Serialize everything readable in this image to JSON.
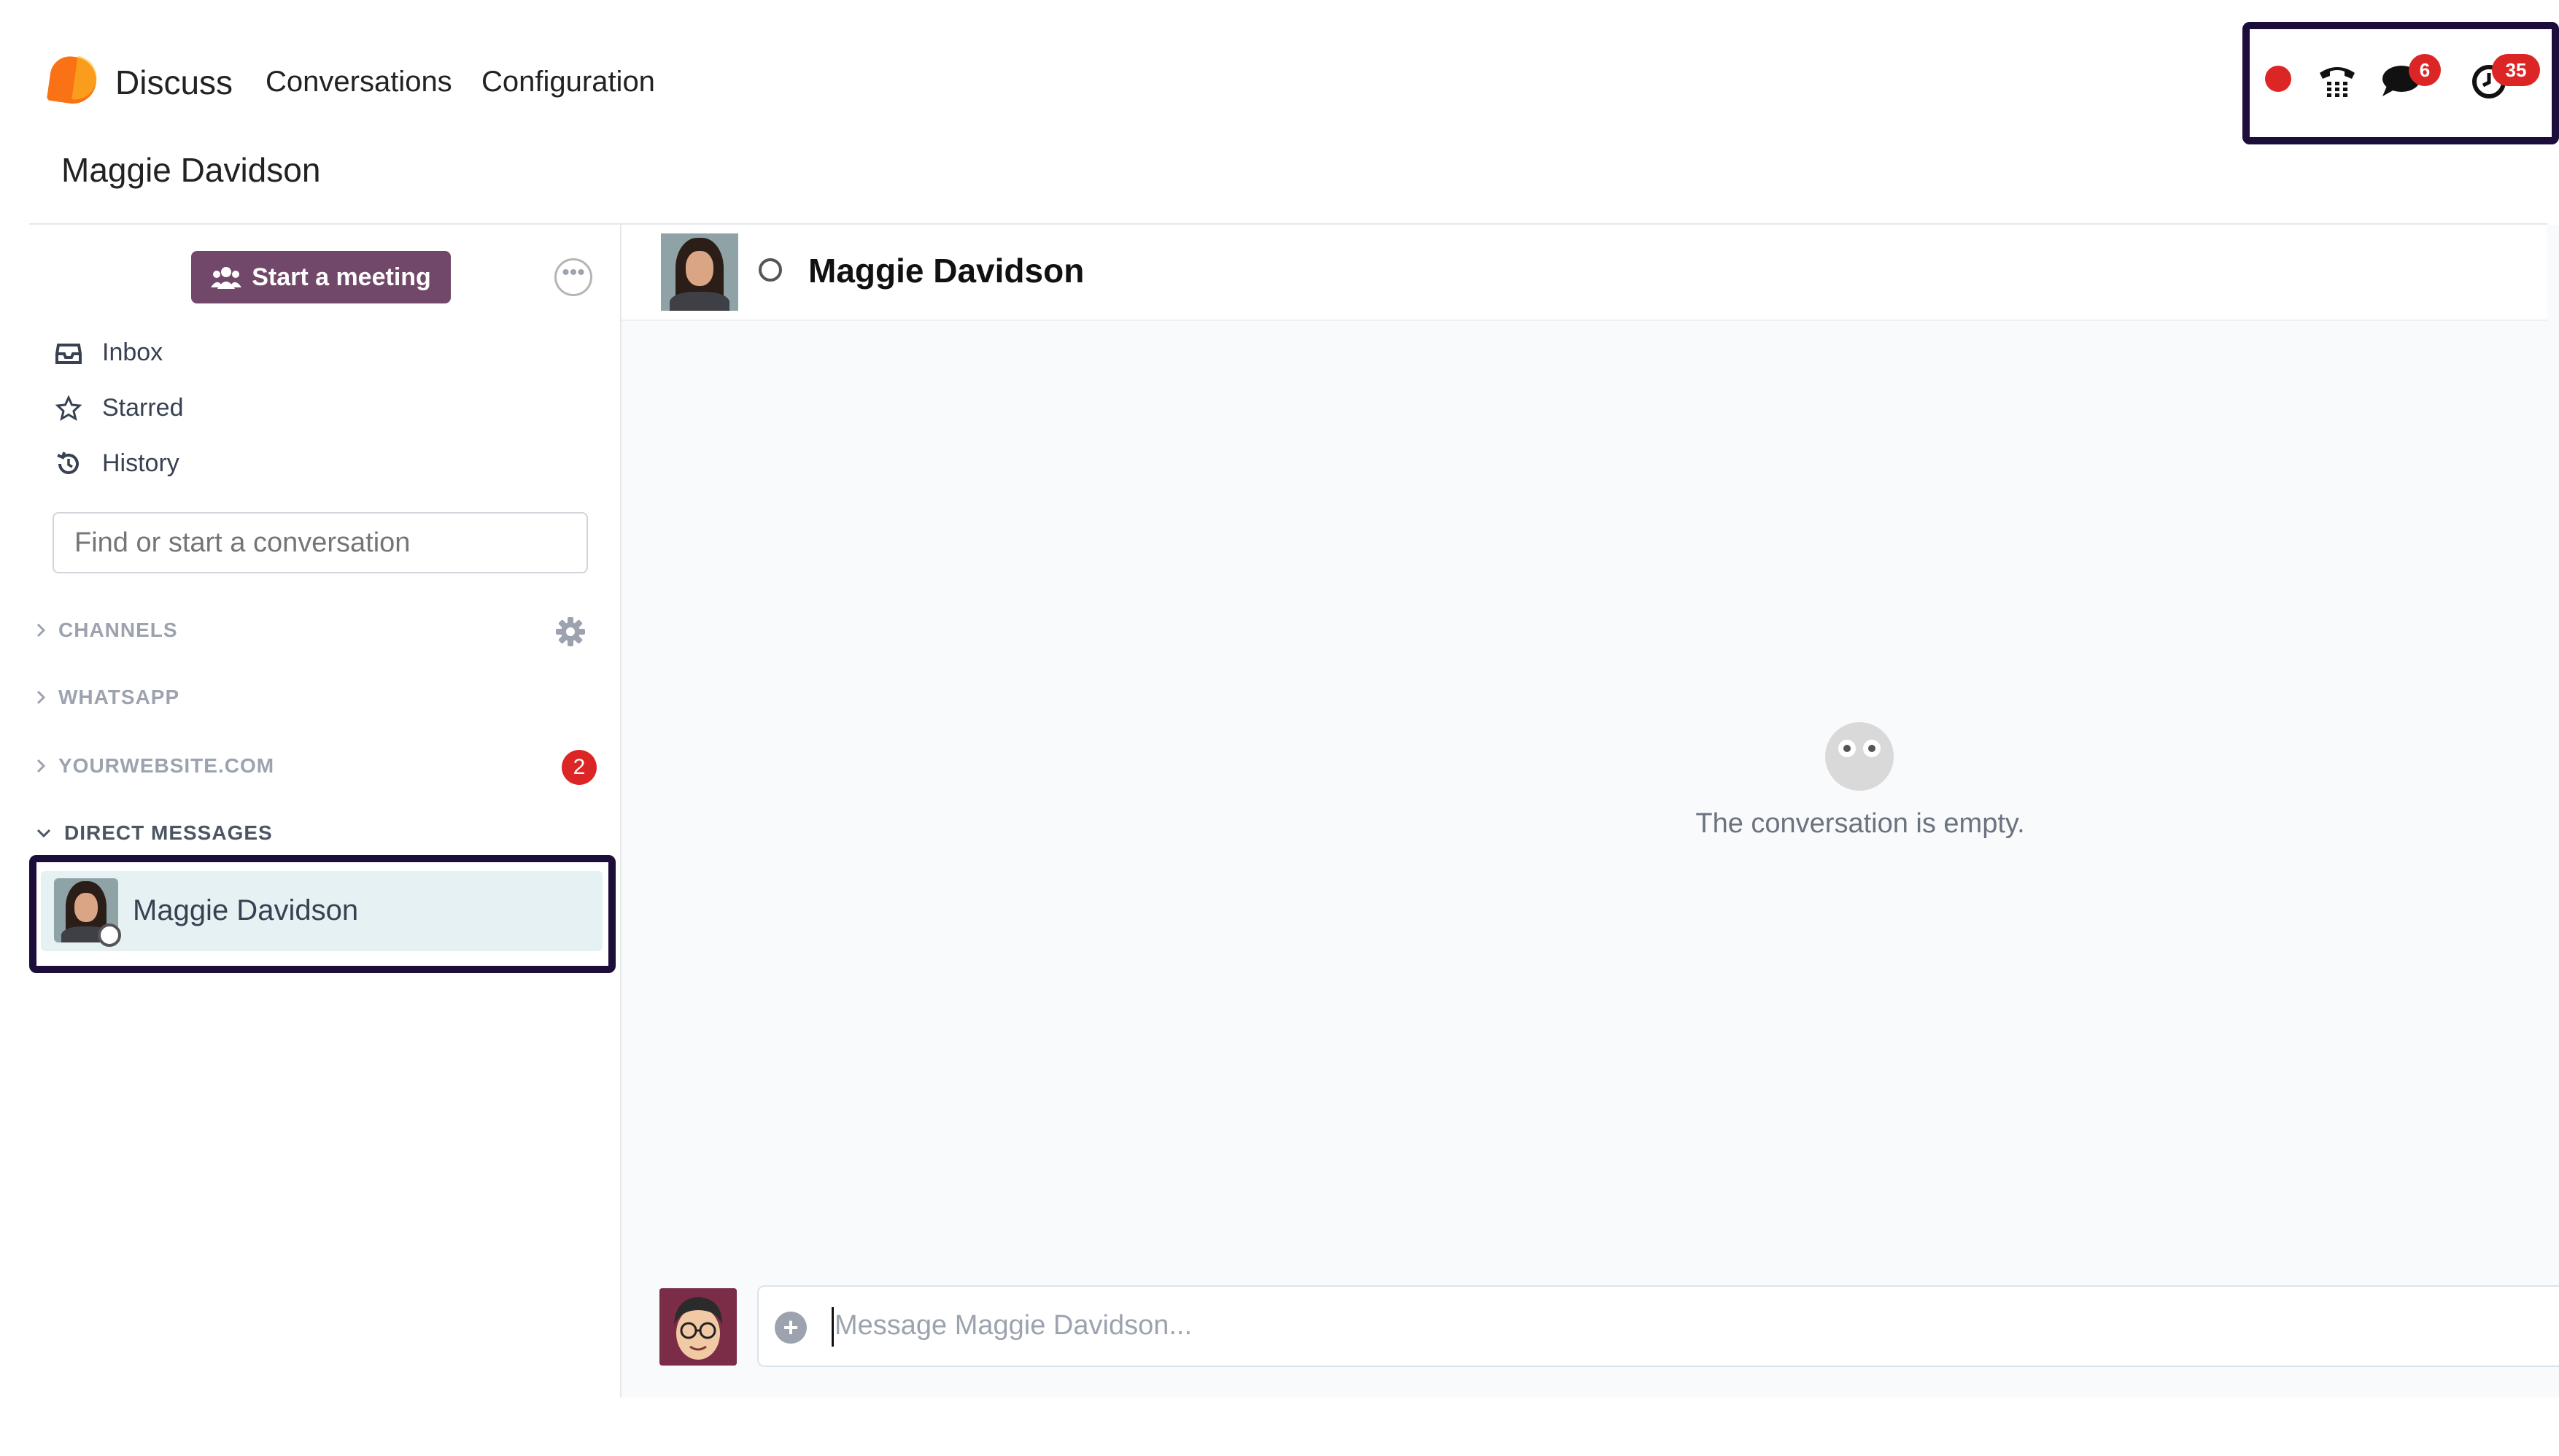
{
  "app": {
    "brand": "Discuss",
    "menu": [
      "Conversations",
      "Configuration"
    ],
    "breadcrumb": "Maggie Davidson",
    "systray": {
      "recording_color": "#dc2626",
      "messages_count": "6",
      "activities_count": "35"
    }
  },
  "sidebar": {
    "start_meeting_label": "Start a meeting",
    "nav": [
      {
        "label": "Inbox",
        "icon": "inbox-icon"
      },
      {
        "label": "Starred",
        "icon": "star-icon"
      },
      {
        "label": "History",
        "icon": "history-icon"
      }
    ],
    "search_placeholder": "Find or start a conversation",
    "categories": [
      {
        "label": "CHANNELS"
      },
      {
        "label": "WHATSAPP"
      },
      {
        "label": "YOURWEBSITE.COM",
        "unread": "2"
      },
      {
        "label": "DIRECT MESSAGES"
      }
    ],
    "direct_messages": [
      {
        "name": "Maggie Davidson"
      }
    ]
  },
  "conversation": {
    "title": "Maggie Davidson",
    "empty_text": "The conversation is empty.",
    "composer_placeholder": "Message Maggie Davidson..."
  },
  "colors": {
    "accent": "#71486a",
    "highlight_border": "#1c0d3a",
    "badge": "#dc2626",
    "selected_row": "#e6f1f3"
  }
}
